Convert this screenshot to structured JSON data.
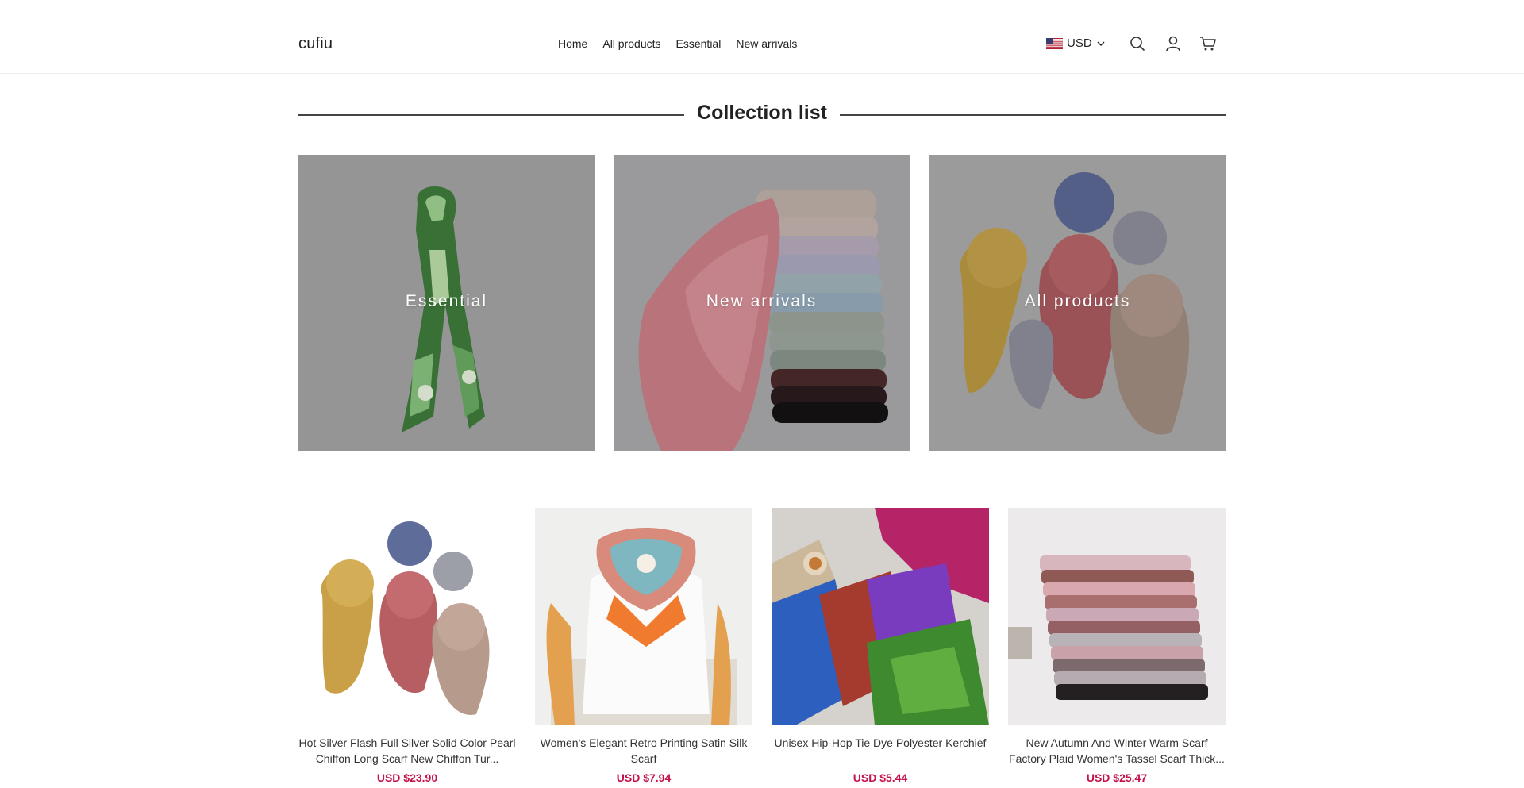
{
  "header": {
    "logo": "cufiu",
    "nav": [
      {
        "label": "Home"
      },
      {
        "label": "All products"
      },
      {
        "label": "Essential"
      },
      {
        "label": "New arrivals"
      }
    ],
    "currency": {
      "label": "USD",
      "flag": "us-flag-icon"
    },
    "icons": [
      "search-icon",
      "account-icon",
      "cart-icon"
    ]
  },
  "collection": {
    "title": "Collection list",
    "items": [
      {
        "label": "Essential",
        "image": "green floral silk twilly scarf"
      },
      {
        "label": "New arrivals",
        "image": "stack of folded chiffon scarves with pink scarf"
      },
      {
        "label": "All products",
        "image": "rolled multicolor scarves"
      }
    ]
  },
  "products": [
    {
      "title": "Hot Silver Flash Full Silver Solid Color Pearl Chiffon Long Scarf New Chiffon Tur...",
      "price": "USD $23.90"
    },
    {
      "title": "Women's Elegant Retro Printing Satin Silk Scarf",
      "price": "USD $7.94"
    },
    {
      "title": "Unisex Hip-Hop Tie Dye Polyester Kerchief",
      "price": "USD $5.44"
    },
    {
      "title": "New Autumn And Winter Warm Scarf Factory Plaid Women's Tassel Scarf Thick...",
      "price": "USD $25.47"
    }
  ],
  "colors": {
    "price": "#c4124a",
    "accent": "#222222"
  }
}
